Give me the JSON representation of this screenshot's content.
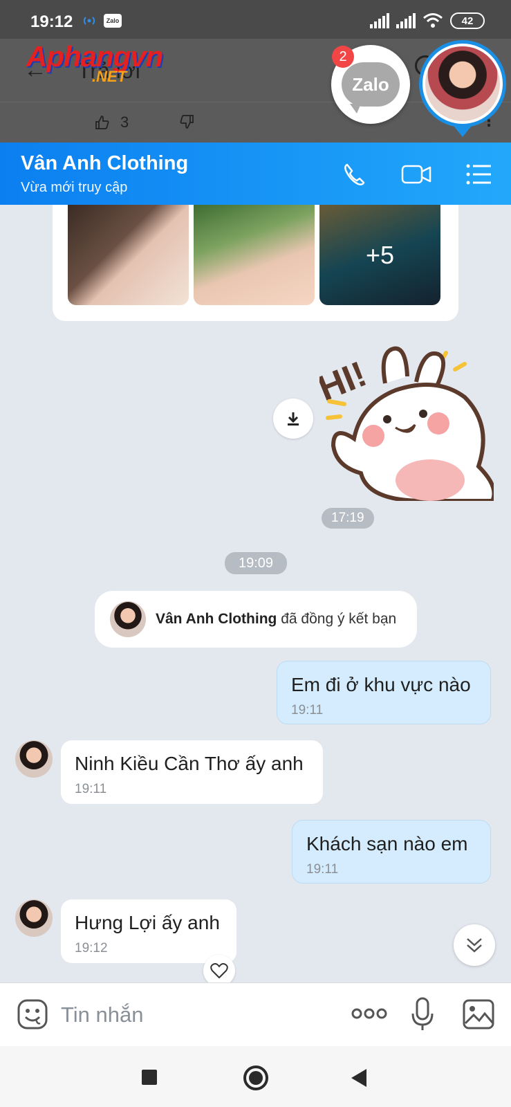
{
  "status_bar": {
    "time": "19:12",
    "app_icon": "Zalo",
    "battery": "42"
  },
  "background": {
    "title": "Trả lời",
    "watermark_main": "Aphangvn",
    "watermark_sub": ".NET",
    "like_count": "3"
  },
  "chat_heads": {
    "app_label": "Zalo",
    "badge_count": "2"
  },
  "chat": {
    "name": "Vân Anh Clothing",
    "status": "Vừa mới truy cập",
    "photos_more": "+5",
    "sticker_time": "17:19",
    "section_time": "19:09",
    "system_name": "Vân Anh Clothing",
    "system_text": " đã đồng ý kết bạn",
    "messages": [
      {
        "text": "Em đi ở khu vực nào",
        "time": "19:11",
        "direction": "out"
      },
      {
        "text": "Ninh Kiều Cần Thơ ấy anh",
        "time": "19:11",
        "direction": "in"
      },
      {
        "text": "Khách sạn nào em",
        "time": "19:11",
        "direction": "out"
      },
      {
        "text": "Hưng Lợi ấy anh",
        "time": "19:12",
        "direction": "in"
      }
    ]
  },
  "input": {
    "placeholder": "Tin nhắn"
  },
  "icons": {
    "accent": "#0b7ff0",
    "header_icons": [
      "phone-icon",
      "video-call-icon",
      "menu-list-icon"
    ],
    "bar_icons": [
      "sticker-emoji-icon",
      "more-options-icon",
      "microphone-icon",
      "image-gallery-icon"
    ]
  }
}
